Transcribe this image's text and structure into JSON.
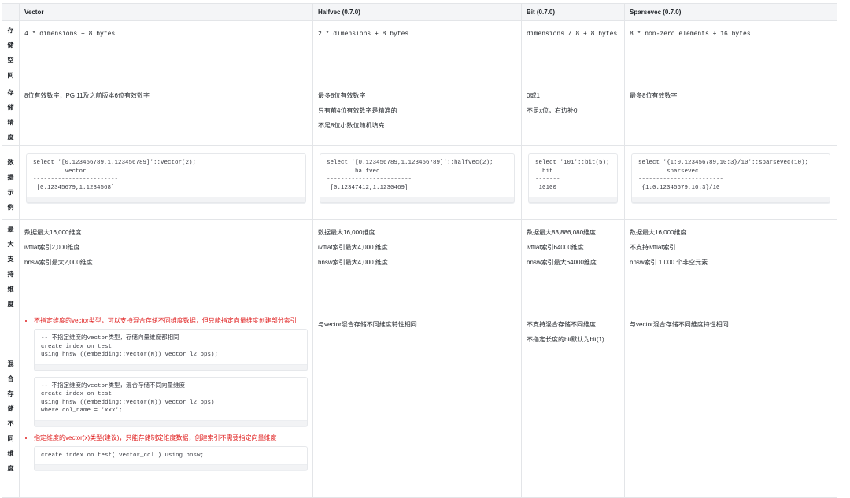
{
  "columns": [
    "Vector",
    "Halfvec (0.7.0)",
    "Bit (0.7.0)",
    "Sparsevec (0.7.0)"
  ],
  "rows": {
    "storage": {
      "label_chars": [
        "存",
        "储",
        "空",
        "间"
      ],
      "vector": "4 * dimensions + 8 bytes",
      "halfvec": "2 * dimensions + 8 bytes",
      "bit": "dimensions / 8 + 8 bytes",
      "sparsevec": "8 * non-zero elements + 16 bytes"
    },
    "precision": {
      "label_chars": [
        "存",
        "储",
        "精",
        "度"
      ],
      "vector": [
        "8位有效数字，PG 11及之前版本6位有效数字"
      ],
      "halfvec": [
        "最多8位有效数字",
        "只有前4位有效数字是精准的",
        "不足8位小数位随机填充"
      ],
      "bit": [
        "0或1",
        "不足x位，右边补0"
      ],
      "sparsevec": [
        "最多8位有效数字"
      ]
    },
    "example": {
      "label_chars": [
        "数",
        "据",
        "示",
        "例"
      ],
      "vector": "select '[0.123456789,1.123456789]'::vector(2);\n         vector\n------------------------\n [0.12345679,1.1234568]",
      "halfvec": "select '[0.123456789,1.123456789]'::halfvec(2);\n        halfvec\n------------------------\n [0.12347412,1.1230469]",
      "bit": "select '101'::bit(5);\n  bit\n-------\n 10100",
      "sparsevec": "select '{1:0.123456789,10:3}/10'::sparsevec(10);\n        sparsevec\n------------------------\n {1:0.12345679,10:3}/10"
    },
    "maxdim": {
      "label_chars": [
        "最",
        "大",
        "支",
        "持",
        "维",
        "度"
      ],
      "vector": [
        "数据最大16,000维度",
        "ivfflat索引2,000维度",
        "hnsw索引最大2,000维度"
      ],
      "halfvec": [
        "数据最大16,000维度",
        "ivfflat索引最大4,000 维度",
        "hnsw索引最大4,000 维度"
      ],
      "bit": [
        "数据最大83,886,080维度",
        "ivfflat索引64000维度",
        "hnsw索引最大64000维度"
      ],
      "sparsevec": [
        "数据最大16,000维度",
        "不支持ivfflat索引",
        "hnsw索引 1,000 个非空元素"
      ]
    },
    "mixed": {
      "label_chars": [
        "混",
        "合",
        "存",
        "储",
        "不",
        "同",
        "维",
        "度"
      ],
      "vector": {
        "bullet1": "不指定维度的vector类型，可以支持混合存储不同维度数据，但只能指定向量维度创建部分索引",
        "code1": "-- 不指定维度的vector类型，存储向量维度都相同\ncreate index on test\nusing hnsw ((embedding::vector(N)) vector_l2_ops);",
        "code2": "-- 不指定维度的vector类型，混合存储不同向量维度\ncreate index on test\nusing hnsw ((embedding::vector(N)) vector_l2_ops)\nwhere col_name = 'xxx';",
        "bullet2": "指定维度的vector(x)类型(建议)，只能存储制定维度数据，创建索引不需要指定向量维度",
        "code3": "create index on test( vector_col ) using hnsw;"
      },
      "halfvec": [
        "与vector混合存储不同维度特性相同"
      ],
      "bit": [
        "不支持混合存储不同维度",
        "不指定长度的bit默认为bit(1)"
      ],
      "sparsevec": [
        "与vector混合存储不同维度特性相同"
      ]
    }
  }
}
